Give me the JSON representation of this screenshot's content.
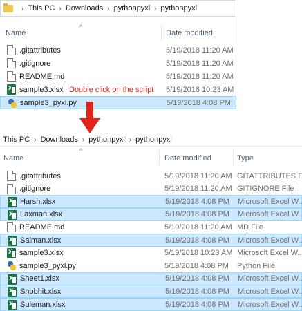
{
  "before": {
    "breadcrumb": [
      "This PC",
      "Downloads",
      "pythonpyxl",
      "pythonpyxl"
    ],
    "columns": {
      "name": "Name",
      "date": "Date modified"
    },
    "files": [
      {
        "name": ".gitattributes",
        "date": "5/19/2018 11:20 AM",
        "icon": "document-icon",
        "selected": false
      },
      {
        "name": ".gitignore",
        "date": "5/19/2018 11:20 AM",
        "icon": "document-icon",
        "selected": false
      },
      {
        "name": "README.md",
        "date": "5/19/2018 11:20 AM",
        "icon": "document-icon",
        "selected": false
      },
      {
        "name": "sample3.xlsx",
        "date": "5/19/2018 10:23 AM",
        "icon": "excel-icon",
        "selected": false
      },
      {
        "name": "sample3_pyxl.py",
        "date": "5/19/2018 4:08 PM",
        "icon": "python-icon",
        "selected": true
      }
    ],
    "annotation": "Double click on the script"
  },
  "after": {
    "breadcrumb": [
      "This PC",
      "Downloads",
      "pythonpyxl",
      "pythonpyxl"
    ],
    "columns": {
      "name": "Name",
      "date": "Date modified",
      "type": "Type"
    },
    "files": [
      {
        "name": ".gitattributes",
        "date": "5/19/2018 11:20 AM",
        "type": "GITATTRIBUTES File",
        "icon": "document-icon",
        "selected": false
      },
      {
        "name": ".gitignore",
        "date": "5/19/2018 11:20 AM",
        "type": "GITIGNORE File",
        "icon": "document-icon",
        "selected": false
      },
      {
        "name": "Harsh.xlsx",
        "date": "5/19/2018 4:08 PM",
        "type": "Microsoft Excel W...",
        "icon": "excel-icon",
        "selected": true
      },
      {
        "name": "Laxman.xlsx",
        "date": "5/19/2018 4:08 PM",
        "type": "Microsoft Excel W...",
        "icon": "excel-icon",
        "selected": true
      },
      {
        "name": "README.md",
        "date": "5/19/2018 11:20 AM",
        "type": "MD File",
        "icon": "document-icon",
        "selected": false
      },
      {
        "name": "Salman.xlsx",
        "date": "5/19/2018 4:08 PM",
        "type": "Microsoft Excel W...",
        "icon": "excel-icon",
        "selected": true
      },
      {
        "name": "sample3.xlsx",
        "date": "5/19/2018 10:23 AM",
        "type": "Microsoft Excel W...",
        "icon": "excel-icon",
        "selected": false
      },
      {
        "name": "sample3_pyxl.py",
        "date": "5/19/2018 4:08 PM",
        "type": "Python File",
        "icon": "python-icon",
        "selected": false
      },
      {
        "name": "Sheet1.xlsx",
        "date": "5/19/2018 4:08 PM",
        "type": "Microsoft Excel W...",
        "icon": "excel-icon",
        "selected": true
      },
      {
        "name": "Shobhit.xlsx",
        "date": "5/19/2018 4:08 PM",
        "type": "Microsoft Excel W...",
        "icon": "excel-icon",
        "selected": true
      },
      {
        "name": "Suleman.xlsx",
        "date": "5/19/2018 4:08 PM",
        "type": "Microsoft Excel W...",
        "icon": "excel-icon",
        "selected": true
      }
    ]
  },
  "colors": {
    "selection_bg": "#cce8ff",
    "selection_border": "#99d1ff",
    "annotation": "#e0241a",
    "arrow": "#e0241a"
  }
}
